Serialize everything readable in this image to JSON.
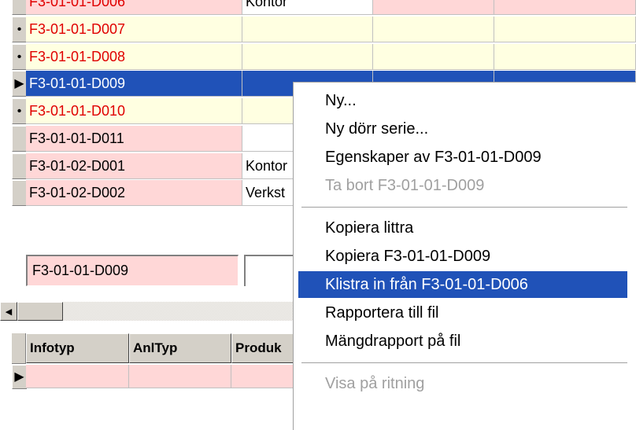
{
  "grid": {
    "rows": [
      {
        "indicator": "",
        "name": "F3-01-01-D006",
        "c2": "Kontor",
        "style": "pink",
        "red": true
      },
      {
        "indicator": "•",
        "name": "F3-01-01-D007",
        "c2": "",
        "style": "yellow",
        "red": true
      },
      {
        "indicator": "•",
        "name": "F3-01-01-D008",
        "c2": "",
        "style": "yellow",
        "red": true
      },
      {
        "indicator": "▶",
        "name": "F3-01-01-D009",
        "c2": "",
        "style": "selected",
        "red": false
      },
      {
        "indicator": "•",
        "name": "F3-01-01-D010",
        "c2": "",
        "style": "yellow",
        "red": true
      },
      {
        "indicator": "",
        "name": "F3-01-01-D011",
        "c2": "",
        "style": "pink",
        "red": false
      },
      {
        "indicator": "",
        "name": "F3-01-02-D001",
        "c2": "Kontor",
        "style": "pink",
        "red": false
      },
      {
        "indicator": "",
        "name": "F3-01-02-D002",
        "c2": "Verkst",
        "style": "pink",
        "red": false
      }
    ]
  },
  "detail": {
    "field_value": "F3-01-01-D009"
  },
  "subgrid": {
    "headers": [
      "Infotyp",
      "AnlTyp",
      "Produk"
    ],
    "row_indicator": "▶"
  },
  "scroll": {
    "left_arrow": "◀"
  },
  "context_menu": {
    "items": [
      {
        "label": "Ny...",
        "disabled": false,
        "highlighted": false
      },
      {
        "label": "Ny dörr serie...",
        "disabled": false,
        "highlighted": false
      },
      {
        "label": "Egenskaper av F3-01-01-D009",
        "disabled": false,
        "highlighted": false
      },
      {
        "label": "Ta bort F3-01-01-D009",
        "disabled": true,
        "highlighted": false
      },
      {
        "separator": true
      },
      {
        "label": "Kopiera littra",
        "disabled": false,
        "highlighted": false
      },
      {
        "label": "Kopiera F3-01-01-D009",
        "disabled": false,
        "highlighted": false
      },
      {
        "label": "Klistra in från F3-01-01-D006",
        "disabled": false,
        "highlighted": true
      },
      {
        "label": "Rapportera till fil",
        "disabled": false,
        "highlighted": false
      },
      {
        "label": "Mängdrapport på fil",
        "disabled": false,
        "highlighted": false
      },
      {
        "separator": true
      },
      {
        "label": "Visa på ritning",
        "disabled": true,
        "highlighted": false
      }
    ]
  },
  "colors": {
    "selection": "#2052b8",
    "pink_row": "#ffd7d7",
    "yellow_row": "#ffffe1",
    "red_text": "#e00000",
    "disabled_text": "#a0a0a0"
  }
}
